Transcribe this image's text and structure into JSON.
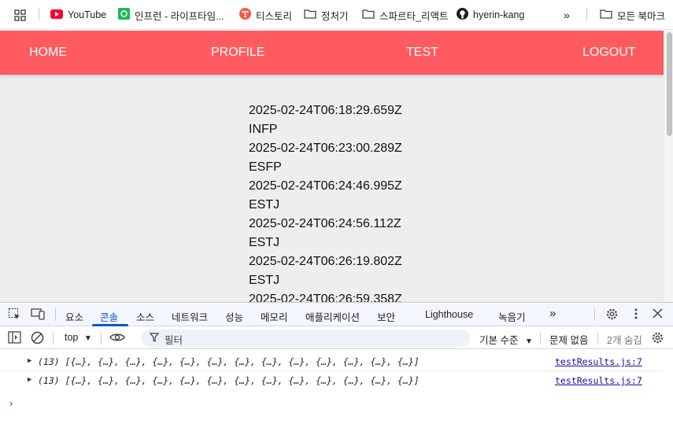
{
  "bookmarks": {
    "items": [
      {
        "label": "YouTube"
      },
      {
        "label": "인프런 - 라이프타임..."
      },
      {
        "label": "티스토리"
      },
      {
        "label": "정처기"
      },
      {
        "label": "스파르타_리액트"
      },
      {
        "label": "hyerin-kang"
      }
    ],
    "all_bookmarks": "모든 북마크"
  },
  "nav": {
    "home": "HOME",
    "profile": "PROFILE",
    "test": "TEST",
    "logout": "LOGOUT"
  },
  "results": [
    "2025-02-24T06:18:29.659Z",
    "INFP",
    "2025-02-24T06:23:00.289Z",
    "ESFP",
    "2025-02-24T06:24:46.995Z",
    "ESTJ",
    "2025-02-24T06:24:56.112Z",
    "ESTJ",
    "2025-02-24T06:26:19.802Z",
    "ESTJ",
    "2025-02-24T06:26:59.358Z"
  ],
  "devtools": {
    "tabs": [
      "요소",
      "콘솔",
      "소스",
      "네트워크",
      "성능",
      "메모리",
      "애플리케이션",
      "보안",
      "Lighthouse",
      "녹음기"
    ],
    "active_tab": "콘솔",
    "toolbar": {
      "context": "top",
      "filter_placeholder": "필터",
      "levels": "기본 수준",
      "issues": "문제 없음",
      "hidden": "2개 숨김"
    },
    "logs": [
      {
        "text": "(13) [{…}, {…}, {…}, {…}, {…}, {…}, {…}, {…}, {…}, {…}, {…}, {…}, {…}]",
        "source": "testResults.js:7"
      },
      {
        "text": "(13) [{…}, {…}, {…}, {…}, {…}, {…}, {…}, {…}, {…}, {…}, {…}, {…}, {…}]",
        "source": "testResults.js:7"
      }
    ]
  }
}
